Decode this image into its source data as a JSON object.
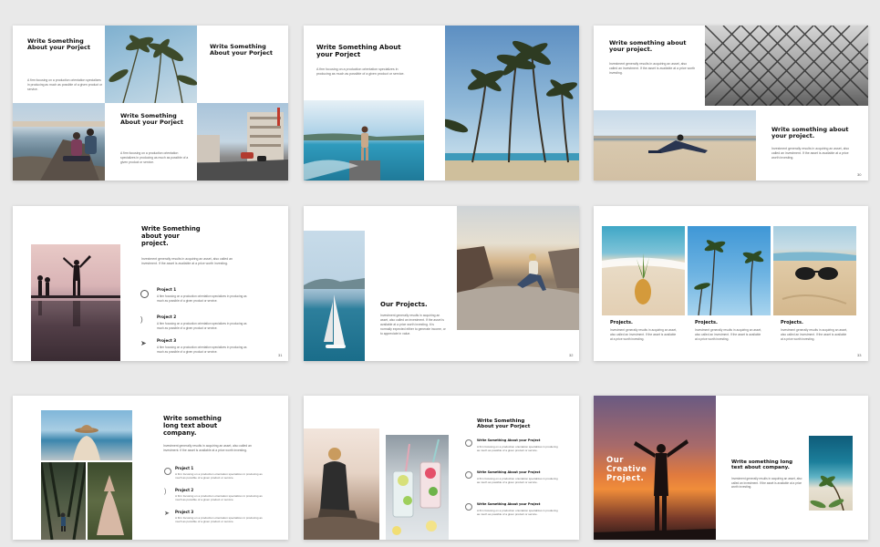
{
  "slides": {
    "s1": {
      "title_a": "Write Something About your Porject",
      "title_b": "Write Something About your Porject",
      "title_c": "Write Something About your Porject",
      "text_a": "A firm focusing on a production orientation specializes in producing as much as possible of a given product or service.",
      "text_c": "A firm focusing on a production orientation specializes in producing as much as possible of a given product or service."
    },
    "s2": {
      "title": "Write Something About your Porject",
      "text": "A firm focusing on a production orientation specializes in producing as much as possible of a given product or service."
    },
    "s3": {
      "title_a": "Write something about your project.",
      "text_a": "Investment generally results in acquiring an asset, also called an investment. If the asset is available at a price worth investing.",
      "title_b": "Write something about your project.",
      "text_b": "Investment generally results in acquiring an asset, also called an investment. If the asset is available at a price worth investing.",
      "page": "30"
    },
    "s4": {
      "title": "Write Something about your project.",
      "text": "Investment generally results in acquiring an asset, also called an investment. If the asset is available at a price worth investing.",
      "items": [
        {
          "label": "Project 1",
          "text": "A firm focusing on a production orientation specializes in producing as much as possible of a given product or service."
        },
        {
          "label": "Project 2",
          "text": "A firm focusing on a production orientation specializes in producing as much as possible of a given product or service."
        },
        {
          "label": "Project 3",
          "text": "A firm focusing on a production orientation specializes in producing as much as possible of a given product or service."
        }
      ],
      "page": "31"
    },
    "s5": {
      "title": "Our Projects.",
      "text": "Investment generally results in acquiring an asset, also called an investment. If the asset is available at a price worth investing. It is normally expected either to generate income, or to appreciate in value.",
      "page": "32"
    },
    "s6": {
      "cols": [
        {
          "label": "Projects.",
          "text": "Investment generally results in acquiring an asset, also called an investment. If the asset is available at a price worth investing."
        },
        {
          "label": "Projects.",
          "text": "Investment generally results in acquiring an asset, also called an investment. If the asset is available at a price worth investing."
        },
        {
          "label": "Projects.",
          "text": "Investment generally results in acquiring an asset, also called an investment. If the asset is available at a price worth investing."
        }
      ],
      "page": "33"
    },
    "s7": {
      "title": "Write something long text about company.",
      "text": "Investment generally results in acquiring an asset, also called an investment. If the asset is available at a price worth investing.",
      "items": [
        {
          "label": "Project 1",
          "text": "A firm focusing on a production orientation specializes in producing as much as possible of a given product or service."
        },
        {
          "label": "Project 2",
          "text": "A firm focusing on a production orientation specializes in producing as much as possible of a given product or service."
        },
        {
          "label": "Project 3",
          "text": "A firm focusing on a production orientation specializes in producing as much as possible of a given product or service."
        }
      ]
    },
    "s8": {
      "title": "Write Something About your Porject",
      "items": [
        {
          "label": "Write Something About your Project",
          "text": "A firm focusing on a production orientation specializes in producing as much as possible of a given product or service."
        },
        {
          "label": "Write Something About your Project",
          "text": "A firm focusing on a production orientation specializes in producing as much as possible of a given product or service."
        },
        {
          "label": "Write Something About your Project",
          "text": "A firm focusing on a production orientation specializes in producing as much as possible of a given product or service."
        }
      ]
    },
    "s9": {
      "overlay_title": "Our Creative Project.",
      "title": "Write something long text about company.",
      "text": "Investment generally results in acquiring an asset, also called an investment. If the asset is available at a price worth investing."
    }
  }
}
